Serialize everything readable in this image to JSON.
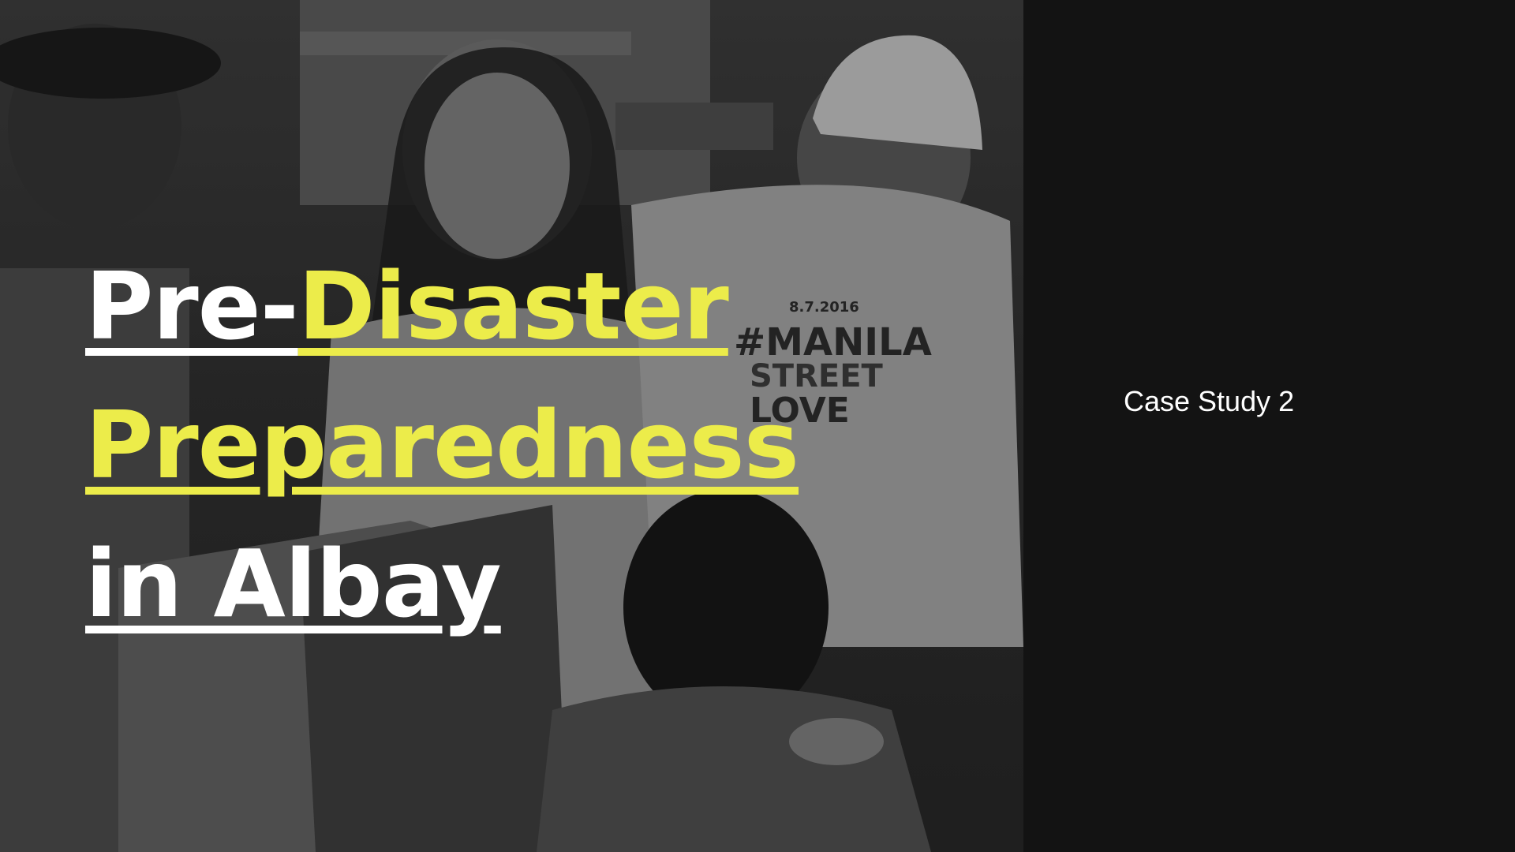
{
  "slide": {
    "title": {
      "line1": {
        "part1": "Pre-",
        "part2": "Disaster"
      },
      "line2": "Preparedness",
      "line3": "in Albay"
    },
    "case_label": "Case Study 2"
  },
  "photo": {
    "shirt_text_1": "8.7.2016",
    "shirt_text_2": "#MANILA",
    "shirt_text_3": "STREET",
    "shirt_text_4": "LOVE"
  },
  "colors": {
    "background": "#131313",
    "accent_yellow": "#ecec4a",
    "text_white": "#ffffff"
  }
}
